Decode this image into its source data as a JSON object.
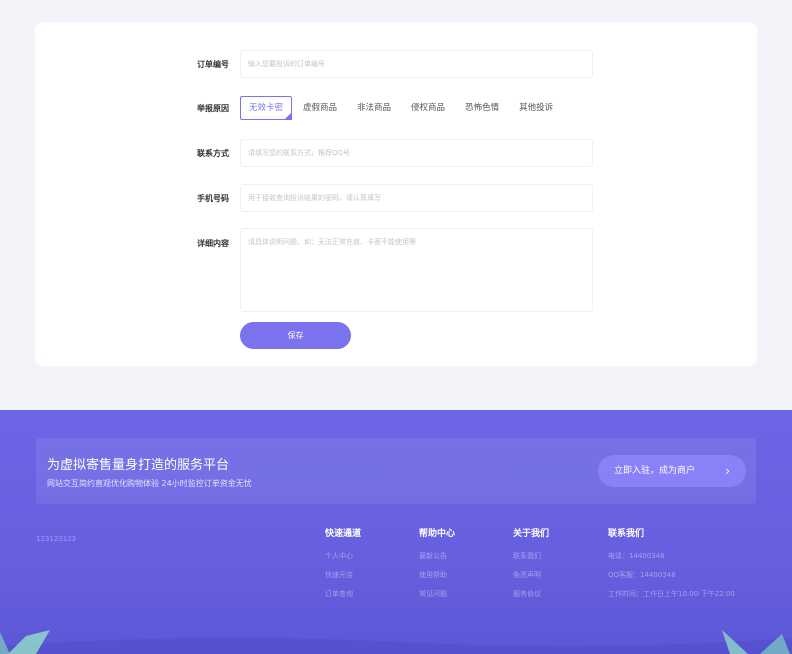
{
  "form": {
    "order_label": "订单编号",
    "order_placeholder": "输入您要投诉的订单编号",
    "type_label": "举报原因",
    "types": [
      "无效卡密",
      "虚假商品",
      "非法商品",
      "侵权商品",
      "恐怖色情",
      "其他投诉"
    ],
    "contact_label": "联系方式",
    "contact_placeholder": "请填写您的联系方式，推荐QQ号",
    "phone_label": "手机号码",
    "phone_placeholder": "用于接收查询投诉结果的密码，请认真填写",
    "detail_label": "详细内容",
    "detail_placeholder": "请具体说明问题，如：无法正常充值、卡密不能使用等",
    "save_label": "保存"
  },
  "footer": {
    "banner_title": "为虚拟寄售量身打造的服务平台",
    "banner_sub": "网站交互简约直观优化购物体验 24小时监控订单资金无忧",
    "cta_label": "立即入驻，成为商户",
    "site_id": "123123123",
    "columns": [
      {
        "title": "快速通道",
        "items": [
          "个人中心",
          "快速开店",
          "订单查询"
        ]
      },
      {
        "title": "帮助中心",
        "items": [
          "最新公告",
          "使用帮助",
          "常见问题"
        ]
      },
      {
        "title": "关于我们",
        "items": [
          "联系我们",
          "免责声明",
          "服务协议"
        ]
      },
      {
        "title": "联系我们",
        "items": [
          "电话：14400348",
          "QQ客服：14400348",
          "工作时间：工作日上午10:00-下午22:00"
        ]
      }
    ]
  },
  "colors": {
    "accent": "#7b73ee",
    "footer": "#6762e2"
  }
}
